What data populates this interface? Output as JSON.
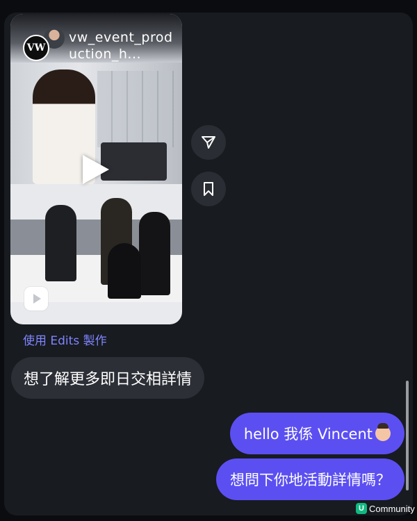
{
  "reel": {
    "account_avatar_text": "VW",
    "username": "vw_event_production_h...",
    "play_icon": "play-icon",
    "badge_icon": "reels-icon"
  },
  "actions": {
    "share_icon": "send-icon",
    "save_icon": "bookmark-icon"
  },
  "edits_label": "使用 Edits 製作",
  "messages": [
    {
      "direction": "incoming",
      "text": "想了解更多即日交相詳情"
    },
    {
      "direction": "outgoing",
      "text": "hello 我係 Vincent",
      "emoji": "person-raising-hand-emoji"
    },
    {
      "direction": "outgoing",
      "text": "想問下你地活動詳情嗎？"
    }
  ],
  "watermark": {
    "logo": "U",
    "text": "Community"
  },
  "colors": {
    "background": "#0b0c10",
    "panel": "#181b20",
    "incoming_bubble": "#2c2f36",
    "outgoing_bubble": "#5b4ff2",
    "link": "#7f85ff"
  }
}
